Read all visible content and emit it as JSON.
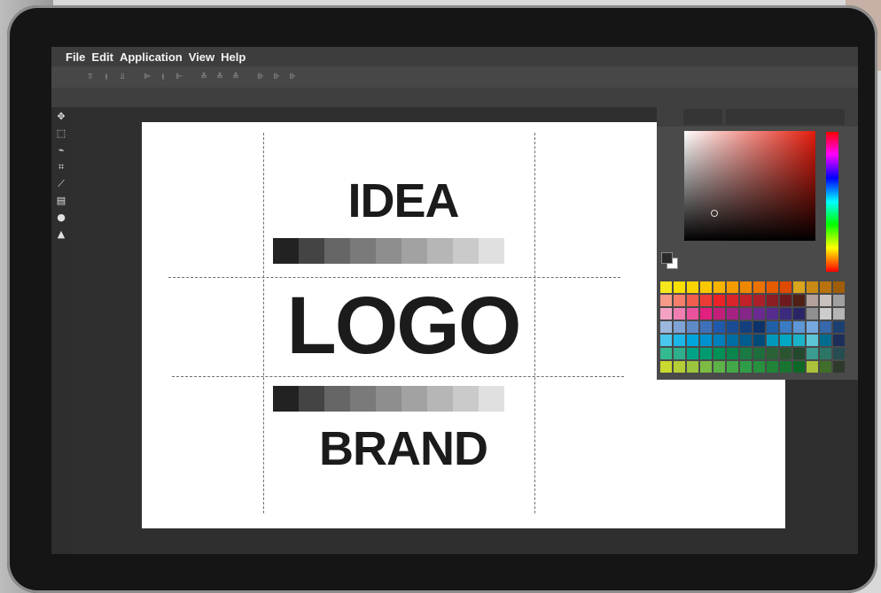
{
  "menubar": {
    "items": [
      "File",
      "Edit",
      "Application",
      "View",
      "Help"
    ]
  },
  "toolbar": {
    "icons": [
      "align-top-icon",
      "align-vcenter-icon",
      "align-bottom-icon",
      "align-left-icon",
      "align-hcenter-icon",
      "align-right-icon",
      "distribute-top-icon",
      "distribute-vcenter-icon",
      "distribute-bottom-icon",
      "distribute-left-icon",
      "distribute-hcenter-icon",
      "distribute-right-icon"
    ]
  },
  "tools": [
    "move-icon",
    "marquee-icon",
    "lasso-icon",
    "crop-icon",
    "eyedropper-icon",
    "gradient-icon",
    "blur-icon",
    "sharpen-icon"
  ],
  "canvas": {
    "top_word": "IDEA",
    "main_word": "LOGO",
    "bottom_word": "BRAND",
    "grayscale": [
      "#222222",
      "#444444",
      "#666666",
      "#7a7a7a",
      "#8e8e8e",
      "#a2a2a2",
      "#b6b6b6",
      "#cacaca",
      "#e0e0e0"
    ]
  },
  "color_panel": {
    "hue_color": "#e31b0b",
    "foreground": "#2a2a2a",
    "background": "#ffffff",
    "palette": [
      [
        "#f7e81b",
        "#f9e000",
        "#f8d500",
        "#f9c800",
        "#f7b300",
        "#f49b00",
        "#ee8700",
        "#ea7200",
        "#e45b00",
        "#de4a00",
        "#d8a51c",
        "#c98a15",
        "#b8730e",
        "#a05d09"
      ],
      [
        "#f59a86",
        "#f37f6c",
        "#ef5e4e",
        "#ec3b34",
        "#e92327",
        "#d9232b",
        "#c22129",
        "#a9202a",
        "#8b1d24",
        "#6c1a1d",
        "#502016",
        "#b4a09a",
        "#c9c1be",
        "#a0a0a0"
      ],
      [
        "#f4a2c3",
        "#ef7fb2",
        "#e9529c",
        "#e2207f",
        "#c41e7b",
        "#a52283",
        "#85268a",
        "#6a2a8f",
        "#552c8e",
        "#3c2a7e",
        "#2a2666",
        "#909090",
        "#cccccc",
        "#b5b5b5"
      ],
      [
        "#9db8de",
        "#7fa3d4",
        "#5f8ac8",
        "#3f70ba",
        "#2159aa",
        "#1a4b94",
        "#133f7f",
        "#0e336a",
        "#1f5fa8",
        "#3a7bc3",
        "#5d97d5",
        "#75a8de",
        "#3768ab",
        "#1d3f70"
      ],
      [
        "#49c7ee",
        "#1db6e8",
        "#00a5df",
        "#0092cf",
        "#007fba",
        "#006da4",
        "#005b8e",
        "#004a78",
        "#0099bb",
        "#00a8c4",
        "#1ab3c8",
        "#5cc6d6",
        "#006d8f",
        "#1d2e58"
      ],
      [
        "#35b991",
        "#2fae8c",
        "#00a385",
        "#009a70",
        "#009157",
        "#0a864c",
        "#1a7a44",
        "#1e6d3c",
        "#2a6136",
        "#2b5431",
        "#24482c",
        "#3a9d8f",
        "#2d7566",
        "#264d52"
      ],
      [
        "#c9d92e",
        "#b3cf35",
        "#9bc53d",
        "#7dbb43",
        "#5cb147",
        "#43a84a",
        "#2f9d48",
        "#26903f",
        "#1f8338",
        "#177530",
        "#0f6828",
        "#aac33b",
        "#3f6f2a",
        "#2e3a2c"
      ]
    ]
  }
}
